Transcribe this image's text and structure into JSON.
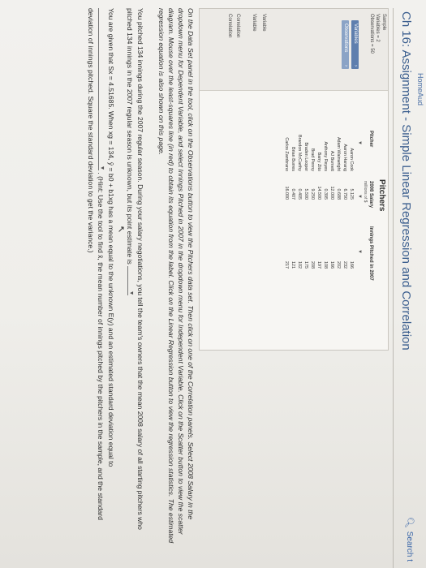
{
  "header": {
    "breadcrumb": "HomeAud",
    "title": "Ch 16: Assignment - Simple Linear Regression and Correlation",
    "search_label": "Search t"
  },
  "tool": {
    "sample_label": "Sample",
    "variables_count": "Variables = 2",
    "observations_count": "Observations = 50",
    "variables_button": "Variables",
    "observations_button": "Observations",
    "left_items": [
      "Variable",
      "Variable",
      "Correlation",
      "Correlation"
    ],
    "panel_title": "Pitchers",
    "columns": {
      "pitcher": "Pitcher",
      "salary": "2008 Salary",
      "salary_sub": "millions of $",
      "innings": "Innings Pitched in 2007"
    },
    "rows": [
      {
        "name": "Aaron Cook",
        "salary": "5.125",
        "innings": "166"
      },
      {
        "name": "Aaron Harang",
        "salary": "6.750",
        "innings": "232"
      },
      {
        "name": "Adam Wainwright",
        "salary": "0.688",
        "innings": "202"
      },
      {
        "name": "AJ Burnett",
        "salary": "12.000",
        "innings": "166"
      },
      {
        "name": "Anthony Reyes",
        "salary": "0.395",
        "innings": "108"
      },
      {
        "name": "Barry Zito",
        "salary": "14.500",
        "innings": "197"
      },
      {
        "name": "Brad Penny",
        "salary": "9.250",
        "innings": "208"
      },
      {
        "name": "Braden Looper",
        "salary": "5.500",
        "innings": "175"
      },
      {
        "name": "Brandon McCarthy",
        "salary": "0.405",
        "innings": "102"
      },
      {
        "name": "Brian Burres",
        "salary": "0.407",
        "innings": "121"
      },
      {
        "name": "Carlos Zambrano",
        "salary": "16.000",
        "innings": "217"
      }
    ]
  },
  "instructions": {
    "p1": "On the Data Set panel in the tool, click on the Observations button to view the Pitchers data set. Then click on one of the Correlation panels. Select 2008 Salary in the dropdown menu for Dependent Variable, and select Innings Pitched in 2007 in the dropdown menu for Independent Variable. Click on the Scatter button to view the scatter diagram. Mouse over the least-squares line (in red) to obtain its equation from the label. Click on the Linear Regression button to view the regression statistics. The estimated regression equation is also shown on this page.",
    "p2a": "You pitched 134 innings during the 2007 regular season. During your salary negotiations, you tell the team's owners that the mean 2008 salary of all starting pitchers who pitched 134 innings in the 2007 regular season is unknown, but its point estimate is",
    "p3a": "You are given that Sx = 4.51685. When xg = 134, ŷ = b0 + b1xg has a mean equal to the unknown E(y) and an estimated standard deviation equal to",
    "p3b": ". (Hint: Use the tool to find x̄, the mean number of innings pitched by the pitchers in the sample, and the standard deviation of innings pitched. Square the standard deviation to get the variance.)"
  }
}
